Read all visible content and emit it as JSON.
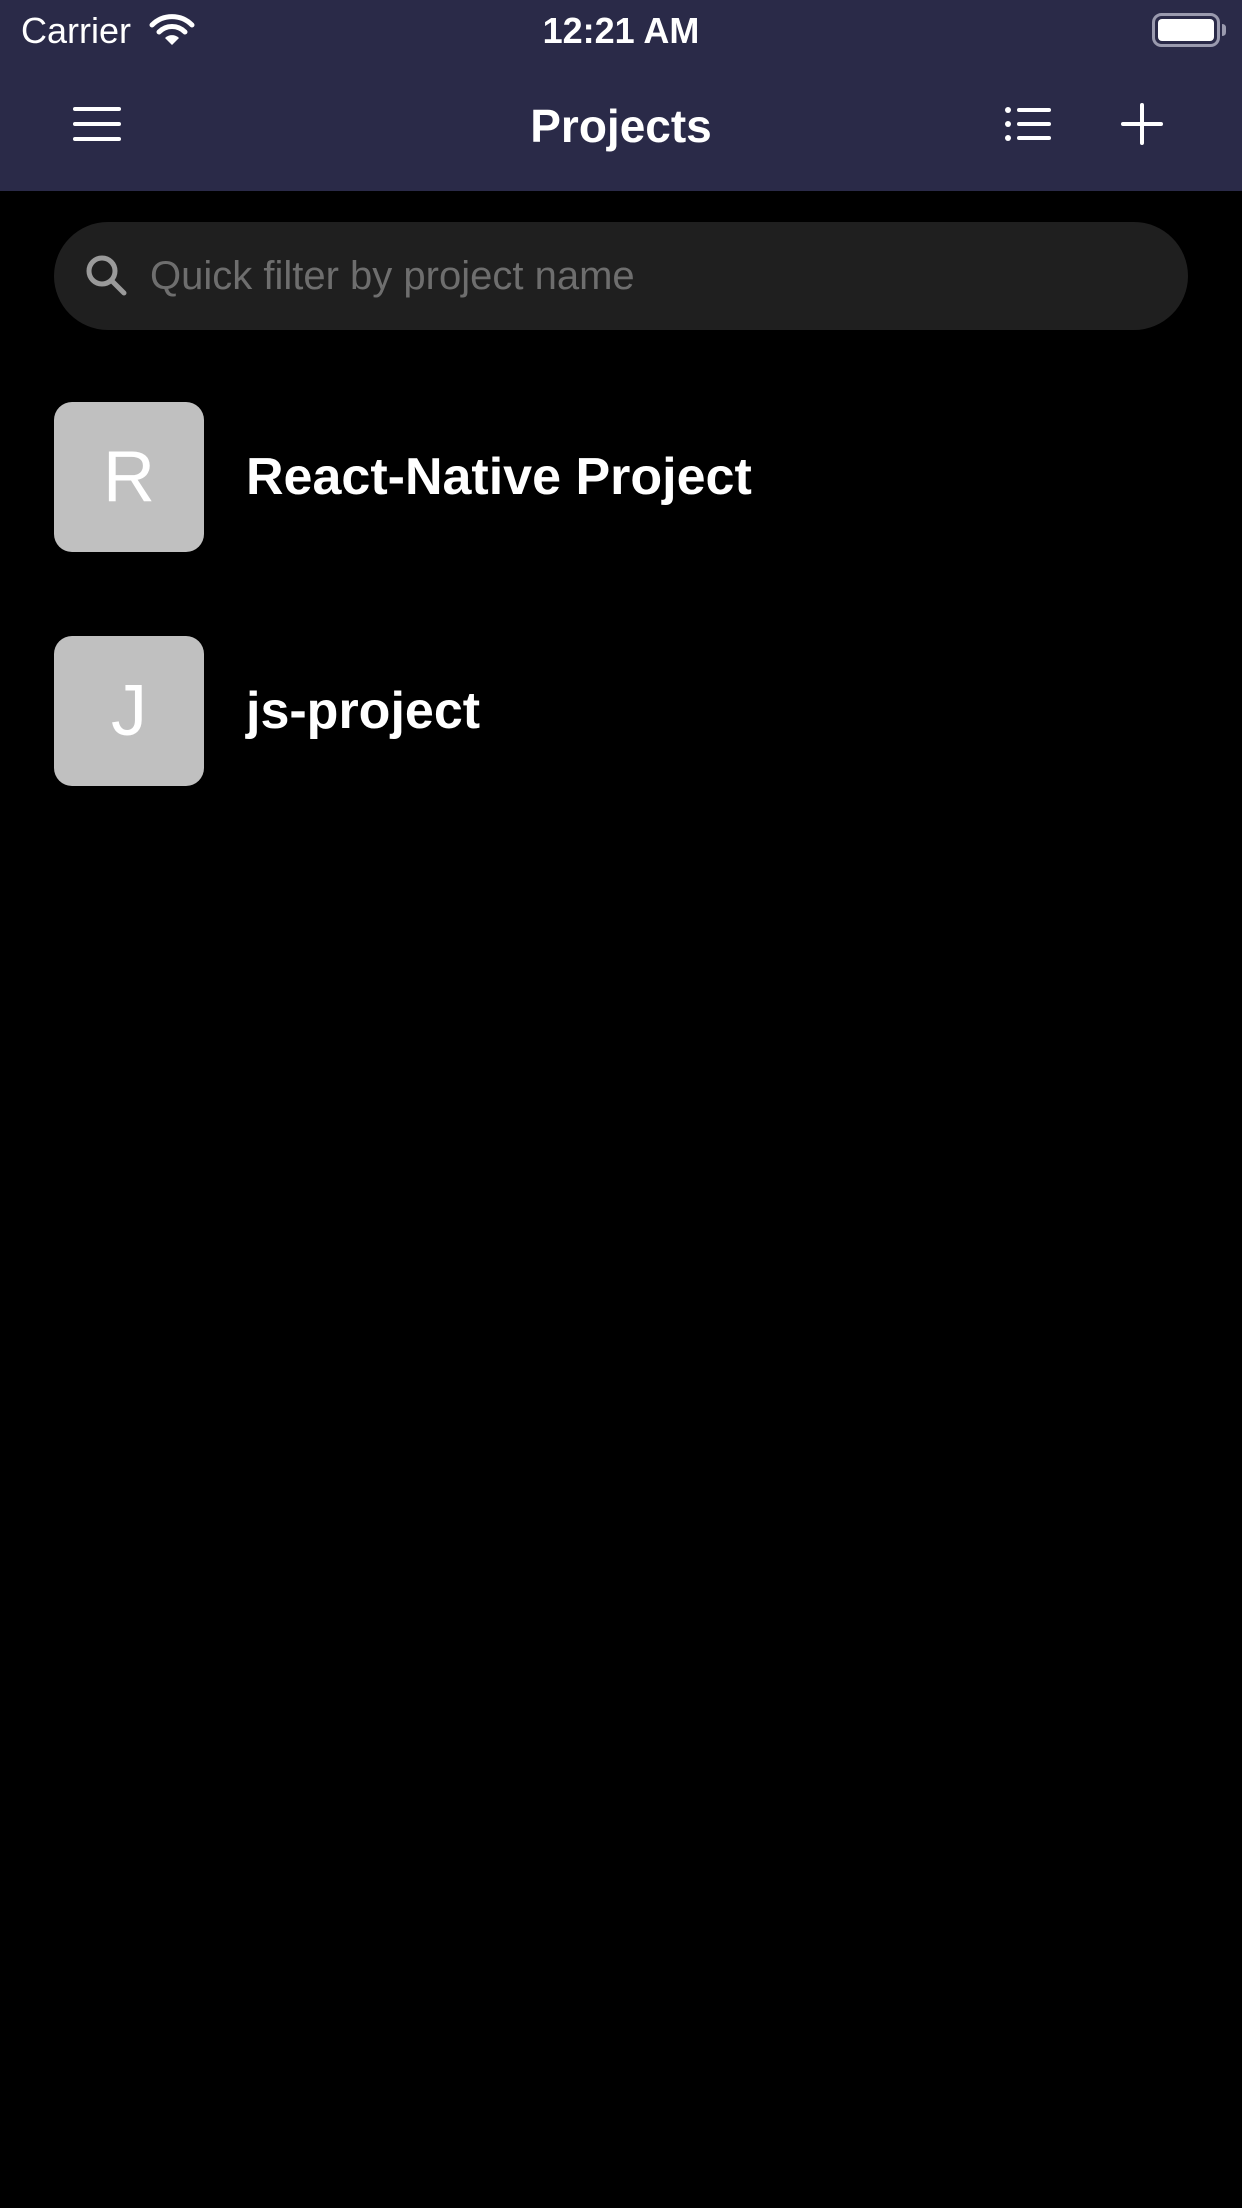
{
  "status_bar": {
    "carrier": "Carrier",
    "time": "12:21 AM",
    "wifi_icon": "wifi-icon",
    "battery_icon": "battery-full-icon"
  },
  "nav": {
    "title": "Projects",
    "menu_icon": "hamburger-menu-icon",
    "list_icon": "list-view-icon",
    "add_icon": "plus-icon"
  },
  "search": {
    "placeholder": "Quick filter by project name",
    "value": "",
    "icon": "search-icon"
  },
  "projects": [
    {
      "initial": "R",
      "name": "React-Native Project"
    },
    {
      "initial": "J",
      "name": "js-project"
    }
  ],
  "colors": {
    "header_background": "#2a2a48",
    "page_background": "#000000",
    "search_background": "#1f1f1f",
    "avatar_background": "#c0c0c0",
    "text": "#ffffff",
    "placeholder": "#6e6e6e"
  }
}
